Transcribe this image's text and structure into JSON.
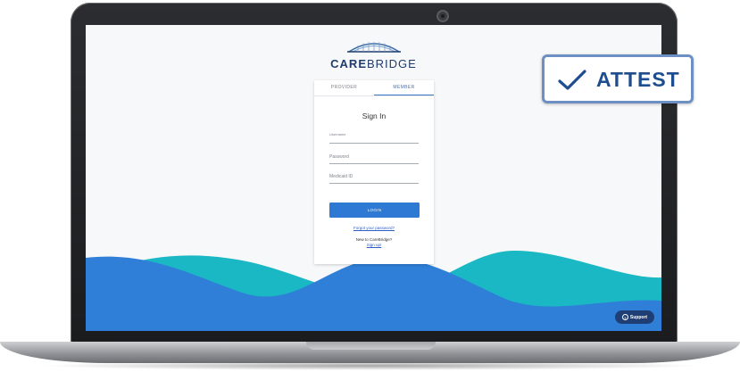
{
  "brand": {
    "name_prefix": "CARE",
    "name_suffix": "BRIDGE"
  },
  "tabs": [
    {
      "label": "PROVIDER",
      "active": false
    },
    {
      "label": "MEMBER",
      "active": true
    }
  ],
  "form": {
    "title": "Sign In",
    "username_label": "Username",
    "password_label": "Password",
    "medicaid_label": "Medicaid ID",
    "login_label": "LOGIN",
    "forgot_link": "Forgot your password?",
    "new_prompt": "New to CareBridge?",
    "signup_link": "Sign up!"
  },
  "support": {
    "label": "Support"
  },
  "badge": {
    "label": "ATTEST"
  },
  "colors": {
    "primary": "#2d79d4",
    "wave_blue": "#2f7fd8",
    "wave_teal": "#1ab8c4",
    "badge_border": "#6d90c4",
    "badge_text": "#1e4e8f",
    "support_bg": "#1f3f74"
  },
  "icons": {
    "logo": "bridge-icon",
    "check": "checkmark-icon",
    "support": "help-circle-icon",
    "camera": "camera-icon"
  }
}
